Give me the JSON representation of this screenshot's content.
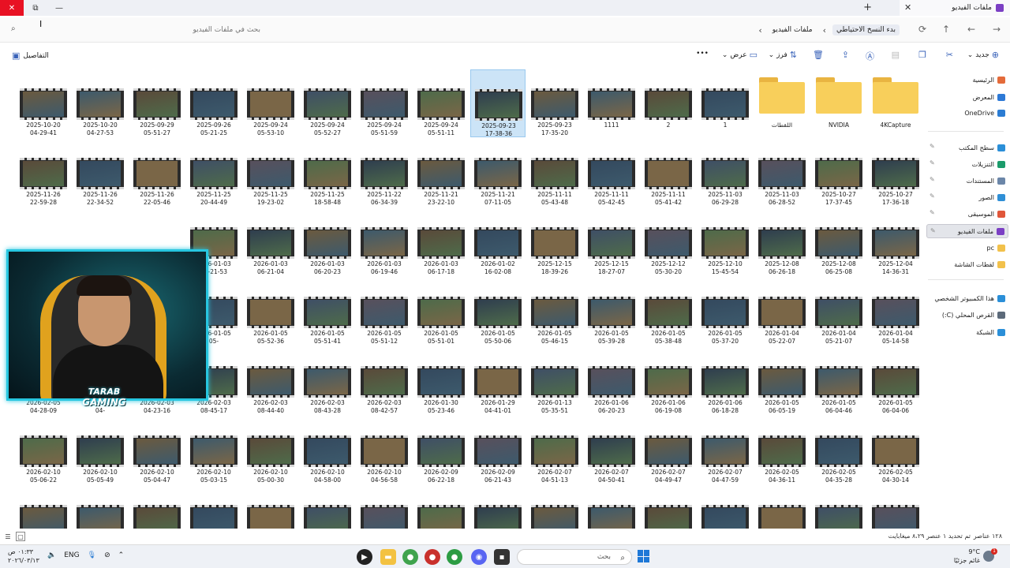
{
  "window": {
    "tab_title": "ملفات الفيديو",
    "tab_close": "✕",
    "new_tab": "+",
    "controls": {
      "minimize": "—",
      "restore": "⧉",
      "close": "✕"
    }
  },
  "address": {
    "back": "←",
    "forward": "→",
    "up": "↑",
    "refresh": "⟳",
    "crumbs": [
      "بدء النسخ الاحتياطي",
      "ملفات الفيديو"
    ],
    "expand": "›",
    "search_placeholder": "بحث في ملفات الفيديو"
  },
  "toolbar": {
    "new": "جديد",
    "sort": "فرز",
    "view": "عرض",
    "more": "•••",
    "details": "التفاصيل"
  },
  "sidebar": {
    "items": [
      {
        "label": "الرئيسية",
        "color": "#e46b3a"
      },
      {
        "label": "المعرض",
        "color": "#2d79d6"
      },
      {
        "label": "OneDrive",
        "color": "#2b7cd3"
      },
      {
        "label": "سطح المكتب",
        "color": "#2b8fd8"
      },
      {
        "label": "التنزيلات",
        "color": "#1b9b6b"
      },
      {
        "label": "المستندات",
        "color": "#6b86a8"
      },
      {
        "label": "الصور",
        "color": "#2f8fd6"
      },
      {
        "label": "الموسيقى",
        "color": "#e0563a"
      },
      {
        "label": "ملفات الفيديو",
        "color": "#7b3fc4"
      },
      {
        "label": "pc",
        "color": "#f2c14b"
      },
      {
        "label": "لقطات الشاشة",
        "color": "#f2c14b"
      },
      {
        "label": "هذا الكمبيوتر الشخصي",
        "color": "#2b8fd8"
      },
      {
        "label": "القرص المحلي (C:)",
        "color": "#5c6a7a"
      },
      {
        "label": "الشبكة",
        "color": "#2b8fd8"
      }
    ]
  },
  "folders": [
    "4KCapture",
    "NVIDIA",
    "اللقطات"
  ],
  "rows": [
    [
      "1",
      "2",
      "1111",
      "2025-09-23\n17-35-20",
      "2025-09-23\n17-38-36",
      "2025-09-24\n05-51-11",
      "2025-09-24\n05-51-59",
      "2025-09-24\n05-52-27",
      "2025-09-24\n05-53-10",
      "2025-09-26\n05-21-25",
      "2025-09-29\n05-51-27",
      "2025-10-20\n04-27-53",
      "2025-10-20\n04-29-41"
    ],
    [
      "2025-10-27\n17-36-18",
      "2025-10-27\n17-37-45",
      "2025-11-03\n06-28-52",
      "2025-11-03\n06-29-28",
      "2025-11-11\n05-41-42",
      "2025-11-11\n05-42-45",
      "2025-11-11\n05-43-48",
      "2025-11-21\n07-11-05",
      "2025-11-21\n23-22-10",
      "2025-11-22\n06-34-39",
      "2025-11-25\n18-58-48",
      "2025-11-25\n19-23-02",
      "2025-11-25\n20-44-49",
      "2025-11-26\n22-05-46",
      "2025-11-26\n22-34-52",
      "2025-11-26\n22-59-28"
    ],
    [
      "2025-12-04\n14-36-31",
      "2025-12-08\n06-25-08",
      "2025-12-08\n06-26-18",
      "2025-12-10\n15-45-54",
      "2025-12-12\n05-30-20",
      "2025-12-15\n18-27-07",
      "2025-12-15\n18-39-26",
      "2026-01-02\n16-02-08",
      "2026-01-03\n06-17-18",
      "2026-01-03\n06-19-46",
      "2026-01-03\n06-20-23",
      "2026-01-03\n06-21-04",
      "2026-01-03\n06-21-53",
      "",
      "",
      ""
    ],
    [
      "2026-01-04\n05-14-58",
      "2026-01-04\n05-21-07",
      "2026-01-04\n05-22-07",
      "2026-01-05\n05-37-20",
      "2026-01-05\n05-38-48",
      "2026-01-05\n05-39-28",
      "2026-01-05\n05-46-15",
      "2026-01-05\n05-50-06",
      "2026-01-05\n05-51-01",
      "2026-01-05\n05-51-12",
      "2026-01-05\n05-51-41",
      "2026-01-05\n05-52-36",
      "2026-01-05\n05-",
      "",
      "",
      ""
    ],
    [
      "2026-01-05\n06-04-06",
      "2026-01-05\n06-04-46",
      "2026-01-05\n06-05-19",
      "2026-01-06\n06-18-28",
      "2026-01-06\n06-19-08",
      "2026-01-06\n06-20-23",
      "2026-01-13\n05-35-51",
      "2026-01-29\n04-41-01",
      "2026-01-30\n05-23-46",
      "2026-02-03\n08-42-57",
      "2026-02-03\n08-43-28",
      "2026-02-03\n08-44-40",
      "2026-02-03\n08-45-17",
      "2026-02-03\n04-23-16",
      "2026-02-03\n04-",
      "2026-02-05\n04-28-09"
    ],
    [
      "2026-02-05\n04-30-14",
      "2026-02-05\n04-35-28",
      "2026-02-05\n04-36-11",
      "2026-02-07\n04-47-59",
      "2026-02-07\n04-49-47",
      "2026-02-07\n04-50-41",
      "2026-02-07\n04-51-13",
      "2026-02-09\n06-21-43",
      "2026-02-09\n06-22-18",
      "2026-02-10\n04-56-58",
      "2026-02-10\n04-58-00",
      "2026-02-10\n05-00-30",
      "2026-02-10\n05-03-15",
      "2026-02-10\n05-04-47",
      "2026-02-10\n05-05-49",
      "2026-02-10\n05-06-22"
    ],
    [
      "2026-02-10",
      "2026-02-10",
      "2026-02-12",
      "2026-02-12",
      "2026-02-12",
      "2026-02-12",
      "2026-02-12",
      "2026-02-12",
      "2026-02-12",
      "2026-02-12",
      "2026-02-12",
      "2026-02-12",
      "2026-02-12",
      "2026-02-12",
      "2026-02-12",
      "2026-02-12"
    ]
  ],
  "status": {
    "count": "١٢٨ عناصر",
    "selected": "تم تحديد ١ عنصر  ٨،٢٩ ميغابايت"
  },
  "webcam": {
    "logo_line1": "TARAB",
    "logo_line2": "GAMING"
  },
  "taskbar": {
    "search_placeholder": "بحث",
    "search_icon": "⌕",
    "lang": "ENG",
    "clock_time": "٠١:٣٣ ص",
    "clock_date": "٢٠٢٦/٠٣/١٣",
    "weather_temp": "9°C",
    "weather_desc": "غائم جزئيًا",
    "weather_badge": "1"
  }
}
